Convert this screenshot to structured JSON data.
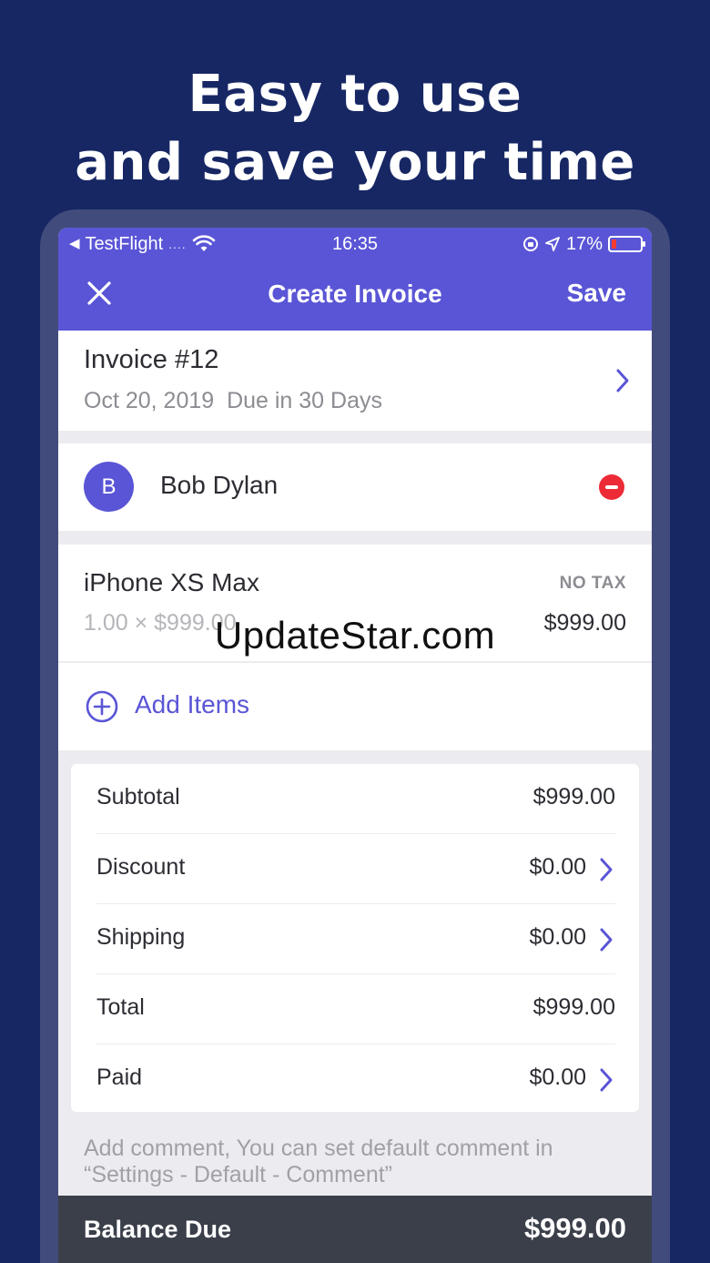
{
  "headline": {
    "line1": "Easy to use",
    "line2": "and save your time"
  },
  "status_bar": {
    "back_app": "TestFlight",
    "signal": "....",
    "time": "16:35",
    "battery_percent": "17%",
    "battery_level": 0.17
  },
  "nav": {
    "close_icon": "close-icon",
    "title": "Create Invoice",
    "save_label": "Save",
    "color": "#5a55d6"
  },
  "invoice": {
    "number": "Invoice #12",
    "date": "Oct 20, 2019",
    "due": "Due in 30 Days"
  },
  "client": {
    "initial": "B",
    "name": "Bob Dylan"
  },
  "item": {
    "name": "iPhone XS Max",
    "tax": "NO TAX",
    "qty_price": "1.00 × $999.00",
    "amount": "$999.00"
  },
  "add_items": {
    "label": "Add Items"
  },
  "summary": {
    "rows": [
      {
        "label": "Subtotal",
        "value": "$999.00"
      },
      {
        "label": "Discount",
        "value": "$0.00"
      },
      {
        "label": "Shipping",
        "value": "$0.00"
      },
      {
        "label": "Total",
        "value": "$999.00"
      },
      {
        "label": "Paid",
        "value": "$0.00"
      }
    ]
  },
  "comment": {
    "text": "Add comment, You can set default comment in “Settings - Default - Comment”"
  },
  "balance": {
    "label": "Balance Due",
    "value": "$999.00"
  },
  "watermark": "UpdateStar.com",
  "colors": {
    "background": "#172764",
    "accent": "#5a55d6",
    "danger": "#ec2b37",
    "balance_bar": "#3a3f4a"
  }
}
